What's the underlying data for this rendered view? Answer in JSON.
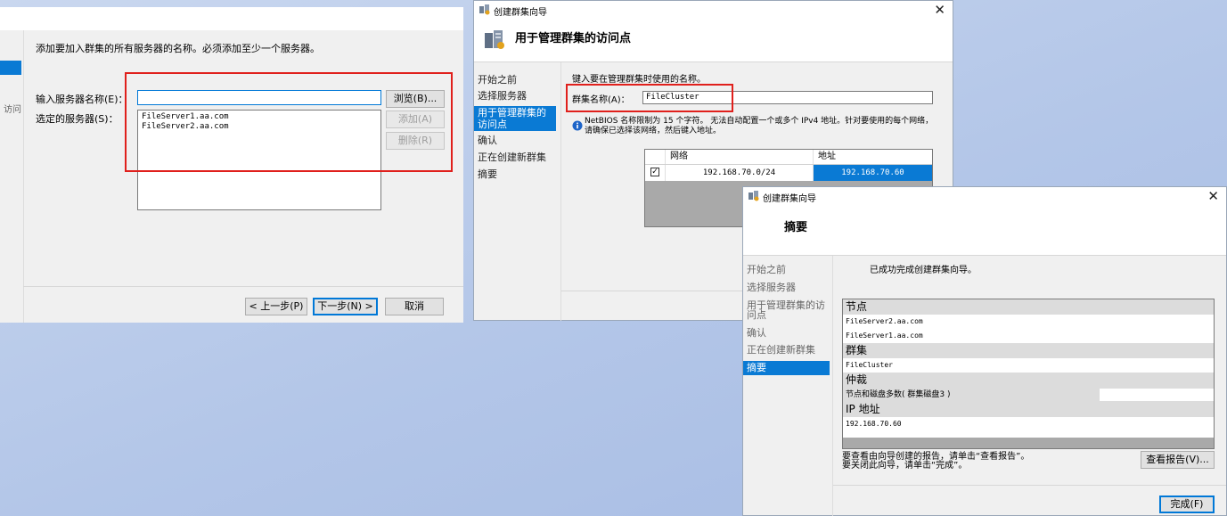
{
  "left_window": {
    "instruction": "添加要加入群集的所有服务器的名称。必须添加至少一个服务器。",
    "left_clip_text": "访问",
    "server_name_label": "输入服务器名称(E)：",
    "server_name_value": "",
    "selected_label": "选定的服务器(S)：",
    "selected_servers": [
      "FileServer1.aa.com",
      "FileServer2.aa.com"
    ],
    "browse_button": "浏览(B)...",
    "add_button": "添加(A)",
    "remove_button": "删除(R)",
    "back_button": "< 上一步(P)",
    "next_button": "下一步(N) >",
    "cancel_button": "取消"
  },
  "middle_window": {
    "title": "创建群集向导",
    "heading": "用于管理群集的访问点",
    "nav": [
      "开始之前",
      "选择服务器",
      "用于管理群集的访问点",
      "确认",
      "正在创建新群集",
      "摘要"
    ],
    "instruction": "键入要在管理群集时使用的名称。",
    "cluster_name_label": "群集名称(A)：",
    "cluster_name_value": "FileCluster",
    "netbios_note": "NetBIOS 名称限制为 15 个字符。 无法自动配置一个或多个 IPv4 地址。针对要使用的每个网络，请确保已选择该网络，然后键入地址。",
    "table_headers": [
      "网络",
      "地址"
    ],
    "table_rows": [
      {
        "network": "192.168.70.0/24",
        "address": "192.168.70.60"
      }
    ]
  },
  "right_window": {
    "title": "创建群集向导",
    "heading": "摘要",
    "nav": [
      "开始之前",
      "选择服务器",
      "用于管理群集的访问点",
      "确认",
      "正在创建新群集",
      "摘要"
    ],
    "success": "已成功完成创建群集向导。",
    "sections": {
      "nodes_title": "节点",
      "node1": "FileServer2.aa.com",
      "node2": "FileServer1.aa.com",
      "cluster_title": "群集",
      "cluster_name": "FileCluster",
      "quorum_title": "仲裁",
      "quorum_value": "节点和磁盘多数( 群集磁盘3 )",
      "ip_title": "IP 地址",
      "ip_value": "192.168.70.60"
    },
    "footer_line1": "要查看由向导创建的报告，请单击“查看报告”。",
    "footer_line2": "要关闭此向导，请单击“完成”。",
    "view_report_button": "查看报告(V)...",
    "finish_button": "完成(F)"
  },
  "colors": {
    "accent": "#0a7ad4",
    "highlight_box": "#e0201c"
  }
}
